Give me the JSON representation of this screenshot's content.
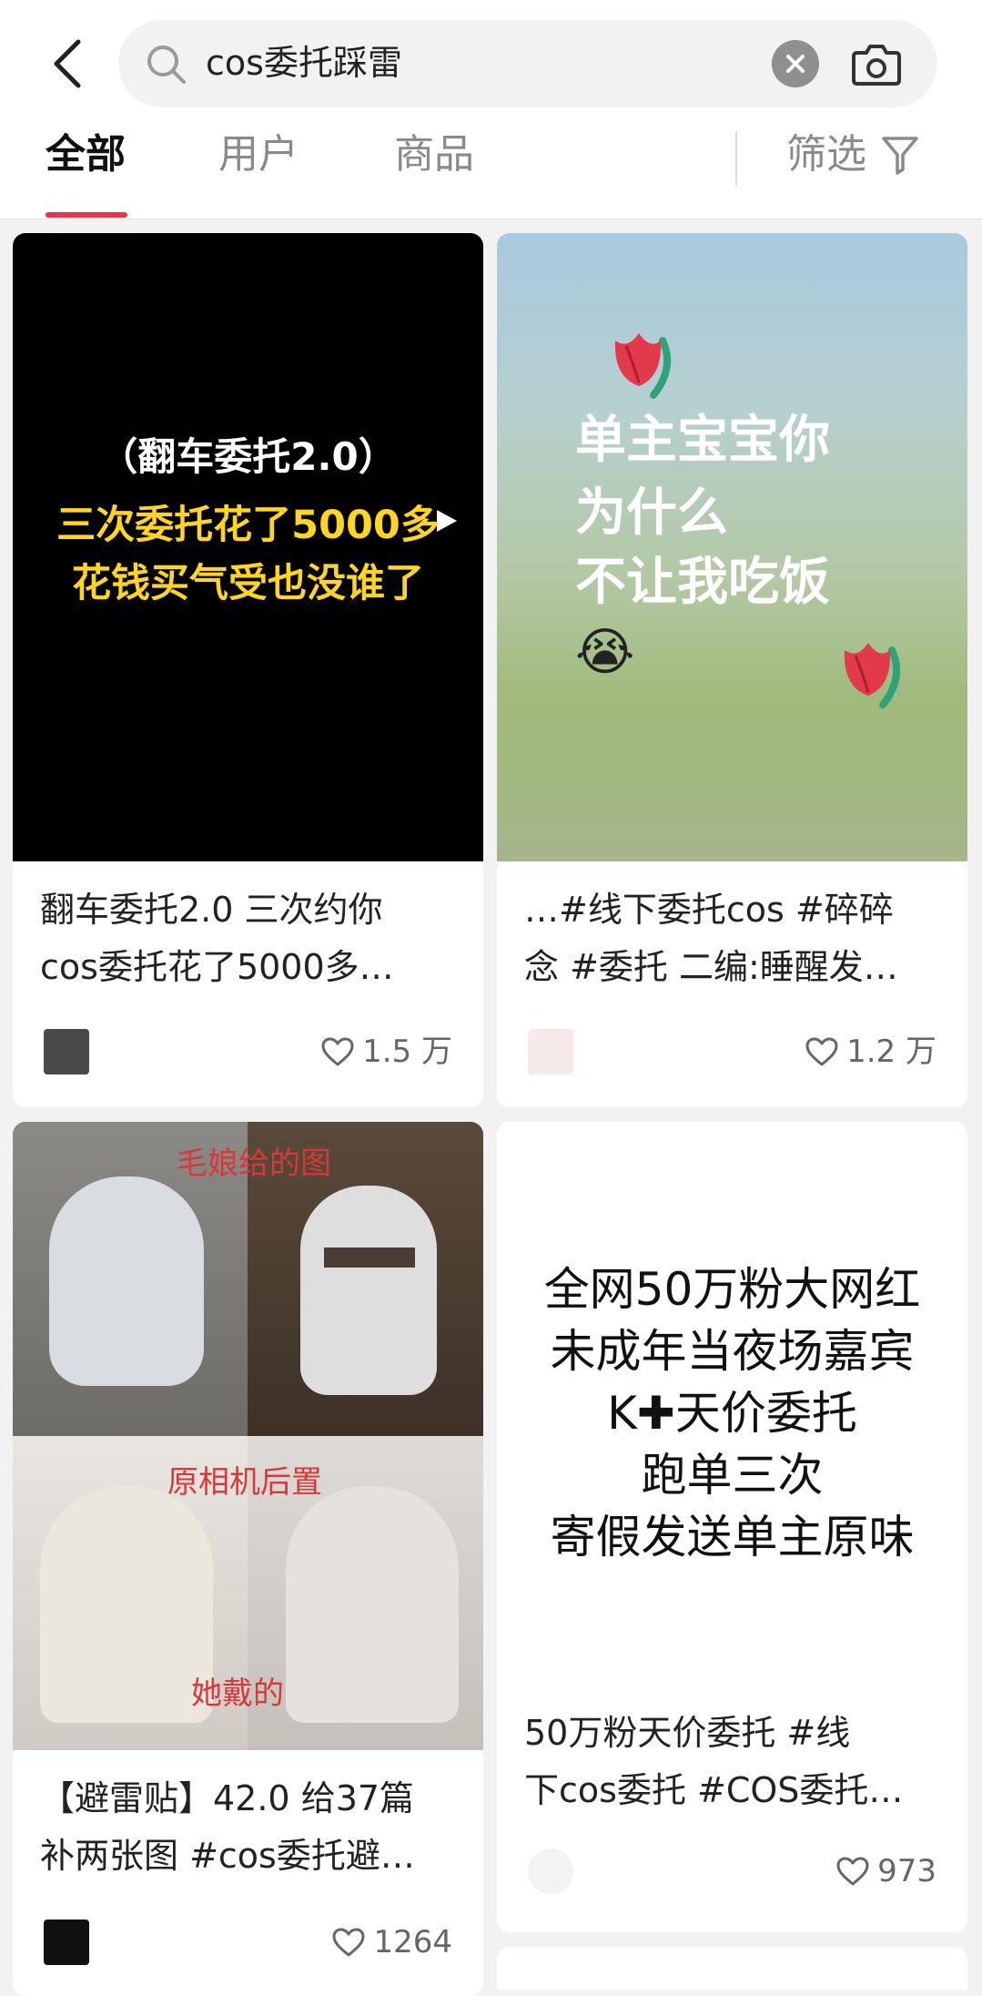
{
  "search": {
    "query": "cos委托踩雷"
  },
  "tabs": [
    {
      "label": "全部",
      "active": true
    },
    {
      "label": "用户",
      "active": false
    },
    {
      "label": "商品",
      "active": false
    }
  ],
  "filter_label": "筛选",
  "colors": {
    "accent": "#e8344b",
    "background": "#f2f2f2",
    "yellow_text": "#ffd51f"
  },
  "cards": [
    {
      "image_title": "（翻车委托2.0）",
      "image_lines": [
        "三次委托花了5000多",
        "花钱买气受也没谁了"
      ],
      "caption_lines": [
        "翻车委托2.0 三次约你",
        "cos委托花了5000多…"
      ],
      "likes": "1.5 万",
      "is_video": true
    },
    {
      "image_lines": [
        "单主宝宝你",
        "为什么",
        "不让我吃饭"
      ],
      "image_emoji": "😭",
      "caption_lines": [
        "…#线下委托cos #碎碎",
        "念 #委托 二编:睡醒发…"
      ],
      "likes": "1.2 万"
    },
    {
      "image_labels": [
        "毛娘给的图",
        "原相机后置",
        "她戴的"
      ],
      "caption_lines": [
        "【避雷贴】42.0 给37篇",
        "补两张图 #cos委托避…"
      ],
      "likes": "1264"
    },
    {
      "image_lines": [
        "全网50万粉大网红",
        "未成年当夜场嘉宾",
        "K✚天价委托",
        "跑单三次",
        "寄假发送单主原味"
      ],
      "caption_lines": [
        "50万粉天价委托 #线",
        "下cos委托 #COS委托…"
      ],
      "likes": "973"
    }
  ]
}
